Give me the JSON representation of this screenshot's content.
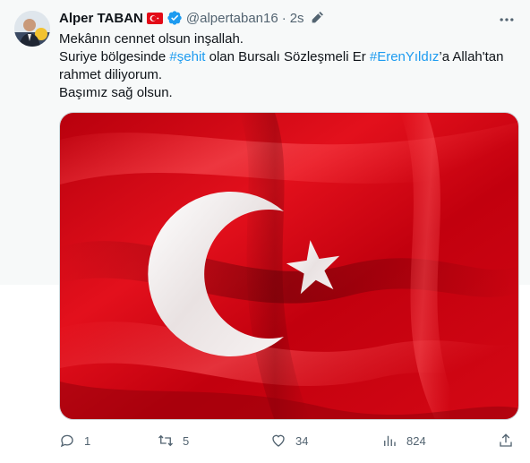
{
  "tweet": {
    "author": {
      "display_name": "Alper TABAN",
      "handle": "@alpertaban16",
      "flag_icon": "turkey-flag-icon",
      "verified_icon": "verified-badge-icon"
    },
    "separator": "·",
    "timestamp": "2s",
    "text_lines": [
      [
        {
          "text": "Mekânın cennet olsun inşallah.",
          "tag": false
        }
      ],
      [
        {
          "text": "Suriye bölgesinde ",
          "tag": false
        },
        {
          "text": "#şehit",
          "tag": true
        },
        {
          "text": " olan Bursalı Sözleşmeli Er ",
          "tag": false
        },
        {
          "text": "#ErenYıldız",
          "tag": true
        },
        {
          "text": "’a Allah'tan",
          "tag": false
        }
      ],
      [
        {
          "text": "rahmet diliyorum.",
          "tag": false
        }
      ],
      [
        {
          "text": "Başımız sağ olsun.",
          "tag": false
        }
      ]
    ],
    "media": {
      "type": "image",
      "subject": "turkish-flag"
    },
    "actions": {
      "reply_count": "1",
      "retweet_count": "5",
      "like_count": "34",
      "view_count": "824"
    }
  },
  "colors": {
    "hashtag": "#1d9bf0",
    "verified": "#1d9bf0",
    "muted": "#536471",
    "flag_red": "#e30a17"
  }
}
